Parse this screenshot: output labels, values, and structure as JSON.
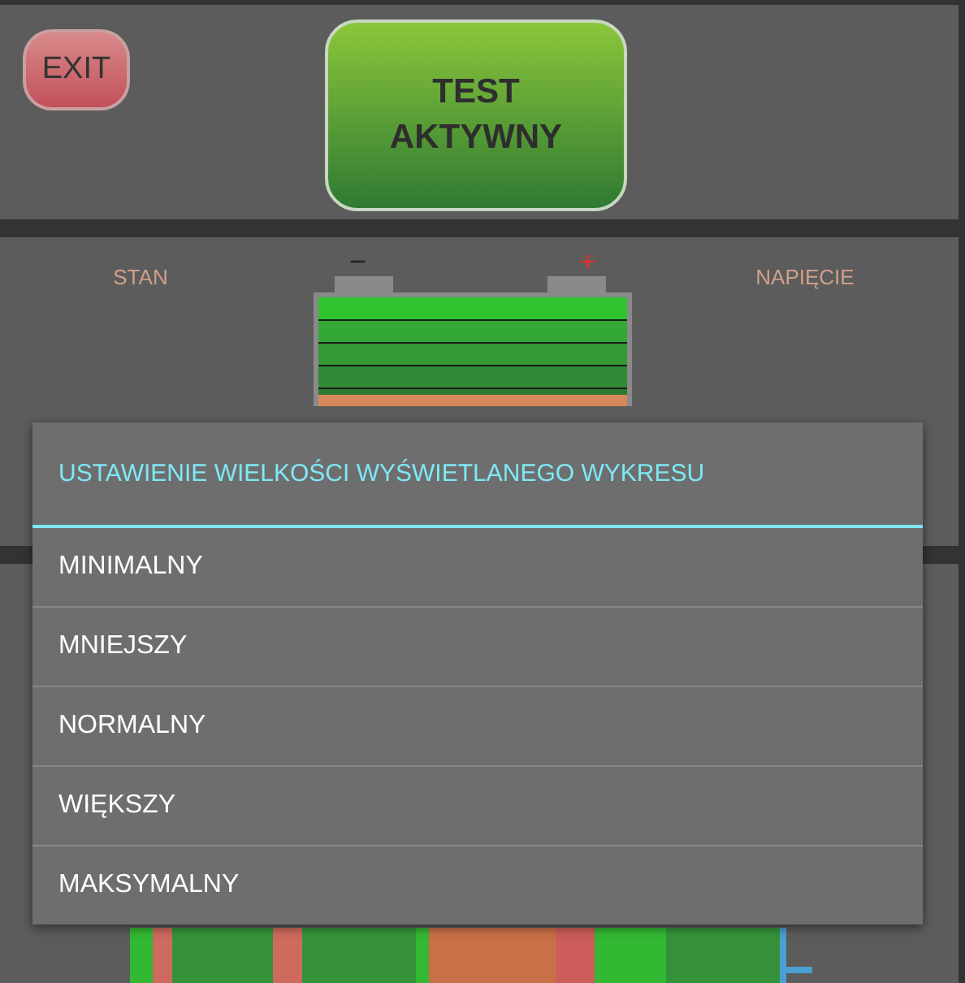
{
  "exit_button": "EXIT",
  "test_button": "TEST\nAKTYWNY",
  "status": {
    "state_label": "STAN",
    "voltage_label": "NAPIĘCIE",
    "battery": {
      "negative": "−",
      "positive": "+"
    }
  },
  "dialog": {
    "title": "USTAWIENIE WIELKOŚCI WYŚWIETLANEGO WYKRESU",
    "options": [
      "MINIMALNY",
      "MNIEJSZY",
      "NORMALNY",
      "WIĘKSZY",
      "MAKSYMALNY"
    ]
  }
}
